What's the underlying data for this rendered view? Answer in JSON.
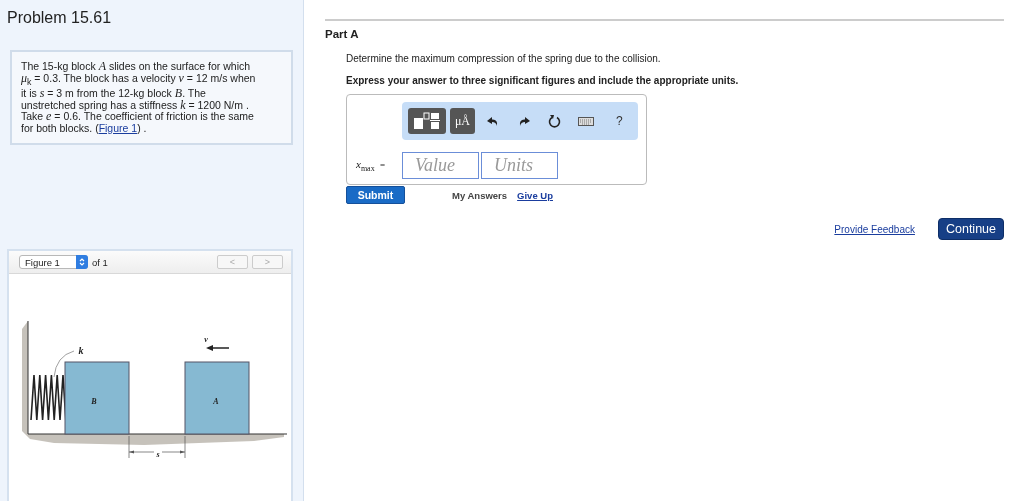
{
  "problem": {
    "title": "Problem 15.61",
    "statement": "The 15-kg block *A* slides on the surface for which *μ*$_{k}$ = 0.3. The block has a velocity *v* = 12  m/s when it is *s* = 3  m from the 12-kg block *B*. The unstretched spring has a stiffness *k* = 1200  N/m . Take *e* = 0.6. The coefficient of friction is the same for both blocks.",
    "figure_ref": {
      "before": "(",
      "link": "Figure 1",
      "after": ") ."
    }
  },
  "figure_viewer": {
    "selector": "Figure 1",
    "count": "of 1",
    "prev": "<",
    "next": ">",
    "prev_disabled": true,
    "next_disabled": true,
    "labels": [
      "k",
      "B",
      "A",
      "v",
      "s"
    ]
  },
  "part": {
    "title": "Part A",
    "question": "Determine the maximum compression of the spring due to the collision.",
    "instruction": "Express your answer to three significant figures and include the appropriate units.",
    "toolbar": {
      "units_button": "μÅ",
      "help": "?"
    },
    "answer": {
      "label": "x",
      "label_sub": "max",
      "equals": "=",
      "value_placeholder": "Value",
      "units_placeholder": "Units"
    },
    "submit": "Submit",
    "my_answers": "My Answers",
    "give_up": "Give Up"
  },
  "footer": {
    "feedback": "Provide Feedback",
    "continue": "Continue"
  }
}
